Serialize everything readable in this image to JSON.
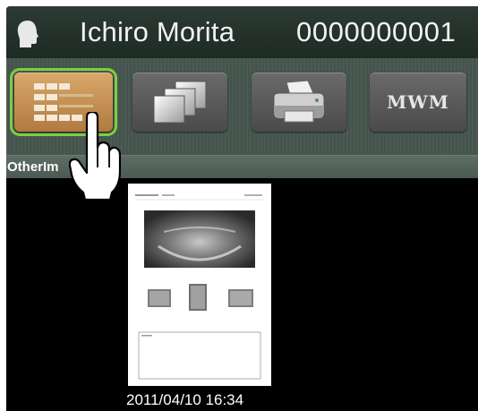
{
  "patient": {
    "name": "Ichiro Morita",
    "id": "0000000001"
  },
  "toolbar": {
    "buttons": [
      {
        "name": "list-view",
        "icon": "list-view-icon",
        "active": true
      },
      {
        "name": "image-stack",
        "icon": "image-stack-icon",
        "active": false
      },
      {
        "name": "print",
        "icon": "printer-icon",
        "active": false
      },
      {
        "name": "mwm",
        "label": "MWM",
        "active": false
      }
    ]
  },
  "tab": {
    "label": "OtherIm"
  },
  "thumbnail": {
    "date": "2011/04/10 16:34"
  },
  "colors": {
    "header_bg": "#26332d",
    "active_button": "#c8945a",
    "active_outline": "#7ccf3f",
    "background": "#000000"
  }
}
